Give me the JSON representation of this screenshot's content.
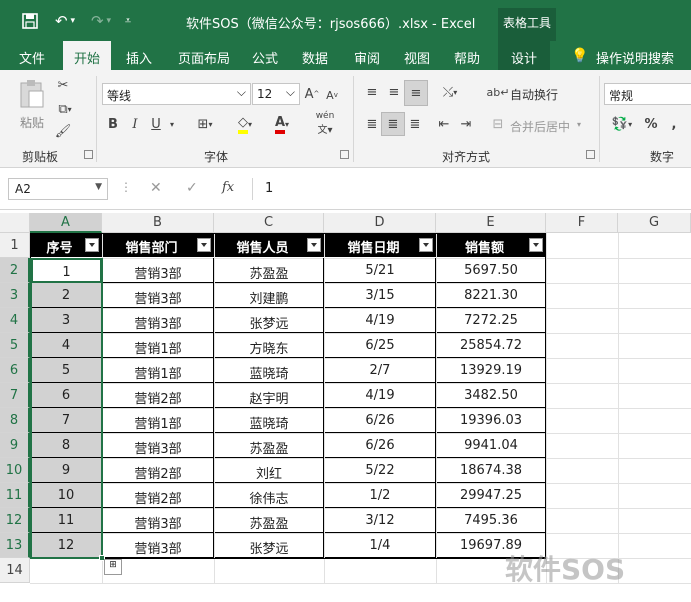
{
  "titlebar": {
    "title": "软件SOS（微信公众号：rjsos666）.xlsx  -  Excel",
    "context_tools": "表格工具",
    "icons": [
      "save-icon",
      "undo-icon",
      "redo-icon",
      "customize-icon"
    ]
  },
  "tabs": [
    "文件",
    "开始",
    "插入",
    "页面布局",
    "公式",
    "数据",
    "审阅",
    "视图",
    "帮助",
    "设计"
  ],
  "tell_me": "操作说明搜索",
  "ribbon": {
    "clipboard": {
      "paste": "粘贴",
      "label": "剪贴板"
    },
    "font": {
      "name": "等线",
      "size": "12",
      "bold": "B",
      "italic": "I",
      "underline": "U",
      "label": "字体",
      "phonetic": "wén"
    },
    "alignment": {
      "wrap": "自动换行",
      "merge": "合并后居中",
      "label": "对齐方式"
    },
    "number": {
      "format": "常规",
      "percent": "%",
      "label": "数字"
    }
  },
  "formula_bar": {
    "name_box": "A2",
    "value": "1"
  },
  "columns": [
    "A",
    "B",
    "C",
    "D",
    "E",
    "F",
    "G"
  ],
  "rows": [
    "1",
    "2",
    "3",
    "4",
    "5",
    "6",
    "7",
    "8",
    "9",
    "10",
    "11",
    "12",
    "13",
    "14"
  ],
  "table": {
    "headers": [
      "序号",
      "销售部门",
      "销售人员",
      "销售日期",
      "销售额"
    ],
    "rows": [
      [
        "1",
        "营销3部",
        "苏盈盈",
        "5/21",
        "5697.50"
      ],
      [
        "2",
        "营销3部",
        "刘建鹏",
        "3/15",
        "8221.30"
      ],
      [
        "3",
        "营销3部",
        "张梦远",
        "4/19",
        "7272.25"
      ],
      [
        "4",
        "营销1部",
        "方晓东",
        "6/25",
        "25854.72"
      ],
      [
        "5",
        "营销1部",
        "蓝晓琦",
        "2/7",
        "13929.19"
      ],
      [
        "6",
        "营销2部",
        "赵宇明",
        "4/19",
        "3482.50"
      ],
      [
        "7",
        "营销1部",
        "蓝晓琦",
        "6/26",
        "19396.03"
      ],
      [
        "8",
        "营销3部",
        "苏盈盈",
        "6/26",
        "9941.04"
      ],
      [
        "9",
        "营销2部",
        "刘红",
        "5/22",
        "18674.38"
      ],
      [
        "10",
        "营销2部",
        "徐伟志",
        "1/2",
        "29947.25"
      ],
      [
        "11",
        "营销3部",
        "苏盈盈",
        "3/12",
        "7495.36"
      ],
      [
        "12",
        "营销3部",
        "张梦远",
        "1/4",
        "19697.89"
      ]
    ]
  },
  "watermark": "软件SOS",
  "colors": {
    "excel_green": "#217346",
    "selection": "#d2d2d2",
    "header_fill": "#000000"
  }
}
